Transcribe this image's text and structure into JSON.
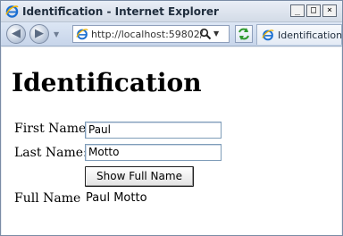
{
  "window": {
    "title": "Identification - Internet Explorer",
    "buttons": {
      "minimize": "_",
      "maximize": "□",
      "close": "×"
    }
  },
  "browser": {
    "address": "http://localhost:59802/",
    "tab_title": "Identification",
    "icons": [
      "back-arrow-icon",
      "forward-arrow-icon",
      "ie-logo-icon",
      "search-icon",
      "refresh-icon"
    ]
  },
  "page": {
    "heading": "Identification",
    "first_name_label": "First Name:",
    "first_name_value": "Paul",
    "last_name_label": "Last Name:",
    "last_name_value": "Motto",
    "button_label": "Show Full Name",
    "full_name_label": "Full Name",
    "full_name_value": "Paul Motto"
  }
}
